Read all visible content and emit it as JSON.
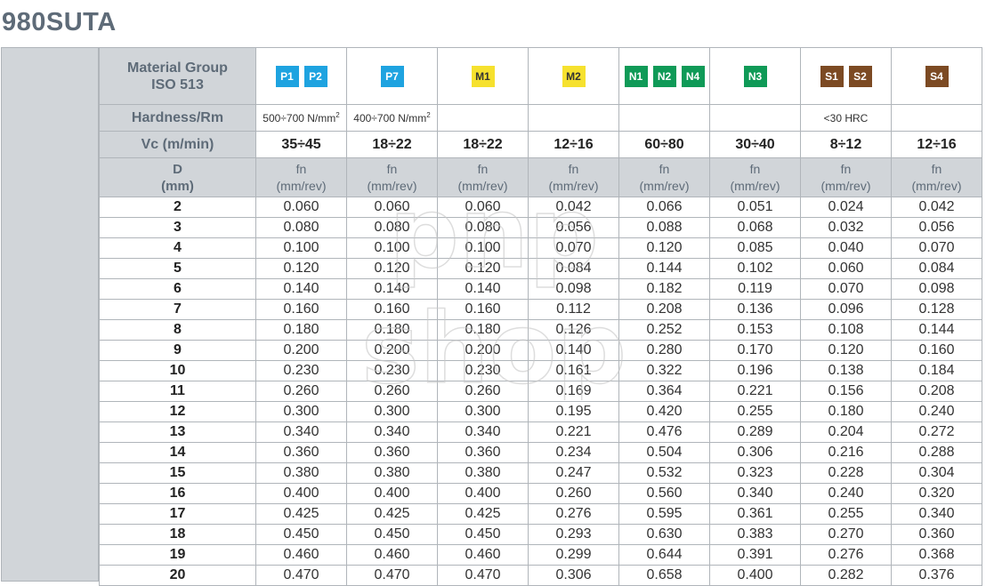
{
  "title": "980SUTA",
  "header": {
    "material_group_label": [
      "Material Group",
      "ISO 513"
    ],
    "hardness_label": "Hardness/Rm",
    "vc_label": "Vc (m/min)",
    "d_label": [
      "D",
      "(mm)"
    ],
    "fn_label": [
      "fn",
      "(mm/rev)"
    ]
  },
  "columns": [
    {
      "groups": [
        "P1",
        "P2"
      ],
      "group_type": "P",
      "hardness": "500÷700 N/mm",
      "hardness_sup": "2",
      "vc": "35÷45"
    },
    {
      "groups": [
        "P7"
      ],
      "group_type": "P",
      "hardness": "400÷700 N/mm",
      "hardness_sup": "2",
      "vc": "18÷22"
    },
    {
      "groups": [
        "M1"
      ],
      "group_type": "M",
      "hardness": "",
      "hardness_sup": "",
      "vc": "18÷22"
    },
    {
      "groups": [
        "M2"
      ],
      "group_type": "M",
      "hardness": "",
      "hardness_sup": "",
      "vc": "12÷16"
    },
    {
      "groups": [
        "N1",
        "N2",
        "N4"
      ],
      "group_type": "N",
      "hardness": "",
      "hardness_sup": "",
      "vc": "60÷80"
    },
    {
      "groups": [
        "N3"
      ],
      "group_type": "N",
      "hardness": "",
      "hardness_sup": "",
      "vc": "30÷40"
    },
    {
      "groups": [
        "S1",
        "S2"
      ],
      "group_type": "S",
      "hardness": "<30 HRC",
      "hardness_sup": "",
      "vc": "8÷12"
    },
    {
      "groups": [
        "S4"
      ],
      "group_type": "S",
      "hardness": "",
      "hardness_sup": "",
      "vc": "12÷16"
    }
  ],
  "colors": {
    "P": "#1ea3e0",
    "M": "#f6e12e",
    "N": "#0f9a57",
    "S": "#7c4a23",
    "header_bg": "#d1d5d9",
    "label_text": "#5e6b78"
  },
  "rows": [
    {
      "d": "2",
      "values": [
        "0.060",
        "0.060",
        "0.060",
        "0.042",
        "0.066",
        "0.051",
        "0.024",
        "0.042"
      ]
    },
    {
      "d": "3",
      "values": [
        "0.080",
        "0.080",
        "0.080",
        "0.056",
        "0.088",
        "0.068",
        "0.032",
        "0.056"
      ]
    },
    {
      "d": "4",
      "values": [
        "0.100",
        "0.100",
        "0.100",
        "0.070",
        "0.120",
        "0.085",
        "0.040",
        "0.070"
      ]
    },
    {
      "d": "5",
      "values": [
        "0.120",
        "0.120",
        "0.120",
        "0.084",
        "0.144",
        "0.102",
        "0.060",
        "0.084"
      ]
    },
    {
      "d": "6",
      "values": [
        "0.140",
        "0.140",
        "0.140",
        "0.098",
        "0.182",
        "0.119",
        "0.070",
        "0.098"
      ]
    },
    {
      "d": "7",
      "values": [
        "0.160",
        "0.160",
        "0.160",
        "0.112",
        "0.208",
        "0.136",
        "0.096",
        "0.128"
      ]
    },
    {
      "d": "8",
      "values": [
        "0.180",
        "0.180",
        "0.180",
        "0.126",
        "0.252",
        "0.153",
        "0.108",
        "0.144"
      ]
    },
    {
      "d": "9",
      "values": [
        "0.200",
        "0.200",
        "0.200",
        "0.140",
        "0.280",
        "0.170",
        "0.120",
        "0.160"
      ]
    },
    {
      "d": "10",
      "values": [
        "0.230",
        "0.230",
        "0.230",
        "0.161",
        "0.322",
        "0.196",
        "0.138",
        "0.184"
      ]
    },
    {
      "d": "11",
      "values": [
        "0.260",
        "0.260",
        "0.260",
        "0.169",
        "0.364",
        "0.221",
        "0.156",
        "0.208"
      ]
    },
    {
      "d": "12",
      "values": [
        "0.300",
        "0.300",
        "0.300",
        "0.195",
        "0.420",
        "0.255",
        "0.180",
        "0.240"
      ]
    },
    {
      "d": "13",
      "values": [
        "0.340",
        "0.340",
        "0.340",
        "0.221",
        "0.476",
        "0.289",
        "0.204",
        "0.272"
      ]
    },
    {
      "d": "14",
      "values": [
        "0.360",
        "0.360",
        "0.360",
        "0.234",
        "0.504",
        "0.306",
        "0.216",
        "0.288"
      ]
    },
    {
      "d": "15",
      "values": [
        "0.380",
        "0.380",
        "0.380",
        "0.247",
        "0.532",
        "0.323",
        "0.228",
        "0.304"
      ]
    },
    {
      "d": "16",
      "values": [
        "0.400",
        "0.400",
        "0.400",
        "0.260",
        "0.560",
        "0.340",
        "0.240",
        "0.320"
      ]
    },
    {
      "d": "17",
      "values": [
        "0.425",
        "0.425",
        "0.425",
        "0.276",
        "0.595",
        "0.361",
        "0.255",
        "0.340"
      ]
    },
    {
      "d": "18",
      "values": [
        "0.450",
        "0.450",
        "0.450",
        "0.293",
        "0.630",
        "0.383",
        "0.270",
        "0.360"
      ]
    },
    {
      "d": "19",
      "values": [
        "0.460",
        "0.460",
        "0.460",
        "0.299",
        "0.644",
        "0.391",
        "0.276",
        "0.368"
      ]
    },
    {
      "d": "20",
      "values": [
        "0.470",
        "0.470",
        "0.470",
        "0.306",
        "0.658",
        "0.400",
        "0.282",
        "0.376"
      ]
    }
  ],
  "watermark": [
    "pnp",
    "shop"
  ]
}
